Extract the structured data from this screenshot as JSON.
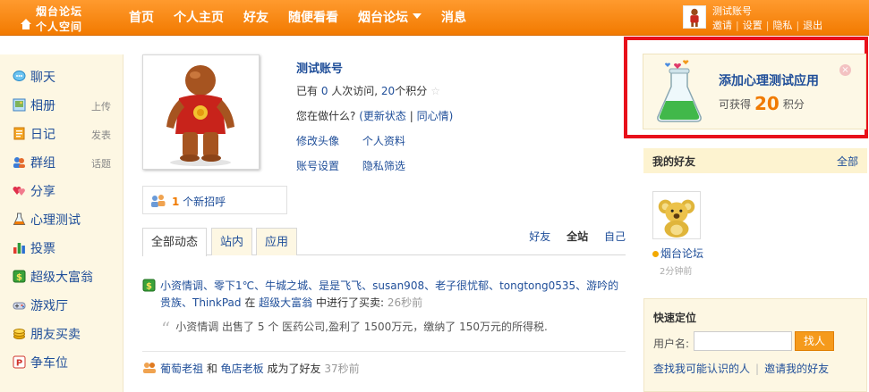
{
  "logo": {
    "line1": "烟台论坛",
    "line2": "个人空间"
  },
  "nav": [
    {
      "label": "首页"
    },
    {
      "label": "个人主页"
    },
    {
      "label": "好友"
    },
    {
      "label": "随便看看"
    },
    {
      "label": "烟台论坛",
      "has_dropdown": true
    },
    {
      "label": "消息"
    }
  ],
  "user": {
    "name": "测试账号",
    "links": [
      "邀请",
      "设置",
      "隐私",
      "退出"
    ]
  },
  "sidebar": {
    "items": [
      {
        "label": "聊天",
        "icon": "chat-bubble-icon",
        "sub": ""
      },
      {
        "label": "相册",
        "icon": "photo-album-icon",
        "sub": "上传"
      },
      {
        "label": "日记",
        "icon": "diary-icon",
        "sub": "发表"
      },
      {
        "label": "群组",
        "icon": "group-icon",
        "sub": "话题"
      },
      {
        "label": "分享",
        "icon": "share-hearts-icon",
        "sub": ""
      },
      {
        "label": "心理测试",
        "icon": "flask-icon",
        "sub": ""
      },
      {
        "label": "投票",
        "icon": "bar-chart-icon",
        "sub": ""
      },
      {
        "label": "超级大富翁",
        "icon": "money-icon",
        "sub": ""
      },
      {
        "label": "游戏厅",
        "icon": "game-controller-icon",
        "sub": ""
      },
      {
        "label": "朋友买卖",
        "icon": "coins-icon",
        "sub": ""
      },
      {
        "label": "争车位",
        "icon": "parking-icon",
        "sub": ""
      }
    ]
  },
  "profile": {
    "name": "测试账号",
    "visits_prefix": "已有 ",
    "visits": "0",
    "visits_suffix": " 人次访问, ",
    "points": "20",
    "points_suffix": "个积分",
    "status_prompt": "您在做什么?",
    "update_status": "(更新状态",
    "same_mood": "同心情)",
    "links_row1": [
      "修改头像",
      "个人资料"
    ],
    "links_row2": [
      "账号设置",
      "隐私筛选"
    ]
  },
  "greeting": {
    "count": "1",
    "text": " 个新招呼"
  },
  "tabs": [
    {
      "label": "全部动态",
      "active": true
    },
    {
      "label": "站内",
      "active": false
    },
    {
      "label": "应用",
      "active": false
    }
  ],
  "filters": [
    {
      "label": "好友",
      "on": false
    },
    {
      "label": "全站",
      "on": true
    },
    {
      "label": "自己",
      "on": false
    }
  ],
  "feed": {
    "item1": {
      "actors": "小资情调、零下1℃、牛城之城、是是飞飞、susan908、老子很忧郁、tongtong0535、游吟的贵族、ThinkPad",
      "mid": " 在 ",
      "app": "超级大富翁",
      "action": " 中进行了买卖: ",
      "time": "26秒前",
      "quote": "小资情调 出售了 5 个 医药公司,盈利了 1500万元，缴纳了 150万元的所得税."
    },
    "item2": {
      "user1": "葡萄老祖",
      "and": " 和 ",
      "user2": "龟店老板",
      "action": " 成为了好友 ",
      "time": "37秒前"
    }
  },
  "app_promo": {
    "title": "添加心理测试应用",
    "earn_prefix": "可获得",
    "earn_value": "20",
    "earn_suffix": "积分",
    "close": "×"
  },
  "friends": {
    "heading": "我的好友",
    "all_link": "全部",
    "list": [
      {
        "name": "烟台论坛",
        "time": "2分钟前"
      }
    ]
  },
  "quick_locate": {
    "title": "快速定位",
    "label": "用户名:",
    "input_value": "",
    "button": "找人",
    "link1": "查找我可能认识的人",
    "link2": "邀请我的好友"
  },
  "colors": {
    "topbar": "#f27a00",
    "link": "#1f4e99",
    "accent": "#f07a00",
    "highlight_frame": "#e8101a"
  }
}
